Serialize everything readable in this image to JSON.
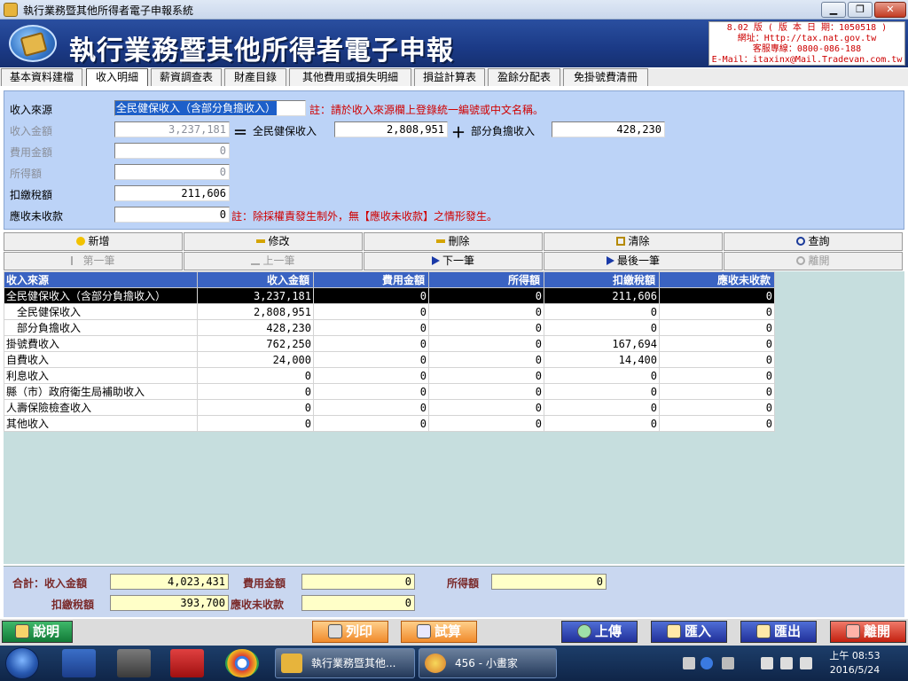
{
  "window": {
    "title": "執行業務暨其他所得者電子申報系統",
    "min_label": "▁",
    "max_label": "❐",
    "close_label": "✕"
  },
  "banner": {
    "title": "執行業務暨其他所得者電子申報",
    "version": "8.02 版 ( 版 本 日 期：1050518 )",
    "website": "網址：Http://tax.nat.gov.tw",
    "hotline": "客服專線：0800-086-188",
    "email": "E-Mail：itaxinx@Mail.Tradevan.com.tw"
  },
  "tabs": [
    {
      "label": "基本資料建檔"
    },
    {
      "label": "收入明細"
    },
    {
      "label": "薪資調查表"
    },
    {
      "label": "財產目錄"
    },
    {
      "label": "其他費用或損失明細"
    },
    {
      "label": "損益計算表"
    },
    {
      "label": "盈餘分配表"
    },
    {
      "label": "免掛號費清冊"
    }
  ],
  "form": {
    "source_label": "收入來源",
    "source_value": "全民健保收入（含部分負擔收入）",
    "source_note": "註：請於收入來源欄上登錄統一編號或中文名稱。",
    "income_label": "收入金額",
    "income_value": "3,237,181",
    "eq": "＝",
    "nhi_label": "全民健保收入",
    "nhi_value": "2,808,951",
    "plus": "＋",
    "partial_label": "部分負擔收入",
    "partial_value": "428,230",
    "expense_label": "費用金額",
    "expense_value": "0",
    "earning_label": "所得額",
    "earning_value": "0",
    "withhold_label": "扣繳稅額",
    "withhold_value": "211,606",
    "receivable_label": "應收未收款",
    "receivable_value": "0",
    "receivable_note": "註：除採權責發生制外，無【應收未收款】之情形發生。"
  },
  "actions": {
    "row1": [
      {
        "label": "新增",
        "icon": "plus-icon"
      },
      {
        "label": "修改",
        "icon": "edit-icon"
      },
      {
        "label": "刪除",
        "icon": "delete-icon"
      },
      {
        "label": "清除",
        "icon": "clear-icon"
      },
      {
        "label": "查詢",
        "icon": "search-icon"
      }
    ],
    "row2": [
      {
        "label": "第一筆",
        "icon": "first-record-icon"
      },
      {
        "label": "上一筆",
        "icon": "prev-record-icon"
      },
      {
        "label": "下一筆",
        "icon": "next-record-icon"
      },
      {
        "label": "最後一筆",
        "icon": "last-record-icon"
      },
      {
        "label": "離開",
        "icon": "power-icon"
      }
    ]
  },
  "grid": {
    "headers": [
      "收入來源",
      "收入金額",
      "費用金額",
      "所得額",
      "扣繳稅額",
      "應收未收款"
    ],
    "rows": [
      [
        "全民健保收入（含部分負擔收入）",
        "3,237,181",
        "0",
        "0",
        "211,606",
        "0"
      ],
      [
        "　全民健保收入",
        "2,808,951",
        "0",
        "0",
        "0",
        "0"
      ],
      [
        "　部分負擔收入",
        "428,230",
        "0",
        "0",
        "0",
        "0"
      ],
      [
        "掛號費收入",
        "762,250",
        "0",
        "0",
        "167,694",
        "0"
      ],
      [
        "自費收入",
        "24,000",
        "0",
        "0",
        "14,400",
        "0"
      ],
      [
        "利息收入",
        "0",
        "0",
        "0",
        "0",
        "0"
      ],
      [
        "縣（市）政府衛生局補助收入",
        "0",
        "0",
        "0",
        "0",
        "0"
      ],
      [
        "人壽保險檢查收入",
        "0",
        "0",
        "0",
        "0",
        "0"
      ],
      [
        "其他收入",
        "0",
        "0",
        "0",
        "0",
        "0"
      ]
    ]
  },
  "summary": {
    "total_income_label": "合計：收入金額",
    "total_income_value": "4,023,431",
    "expense_label": "費用金額",
    "expense_value": "0",
    "earning_label": "所得額",
    "earning_value": "0",
    "withhold_label": "扣繳稅額",
    "withhold_value": "393,700",
    "receivable_label": "應收未收款",
    "receivable_value": "0"
  },
  "bottom_buttons": {
    "help": "說明",
    "print": "列印",
    "trial": "試算",
    "upload": "上傳",
    "import": "匯入",
    "export": "匯出",
    "exit": "離開"
  },
  "taskbar": {
    "task1": "執行業務暨其他...",
    "task2": "456 - 小畫家",
    "time": "上午 08:53",
    "date": "2016/5/24"
  },
  "colors": {
    "header_blue": "#3a63c2",
    "form_bg": "#bcd3f7",
    "note_red": "#d00000",
    "summary_field": "#ffffc8"
  }
}
